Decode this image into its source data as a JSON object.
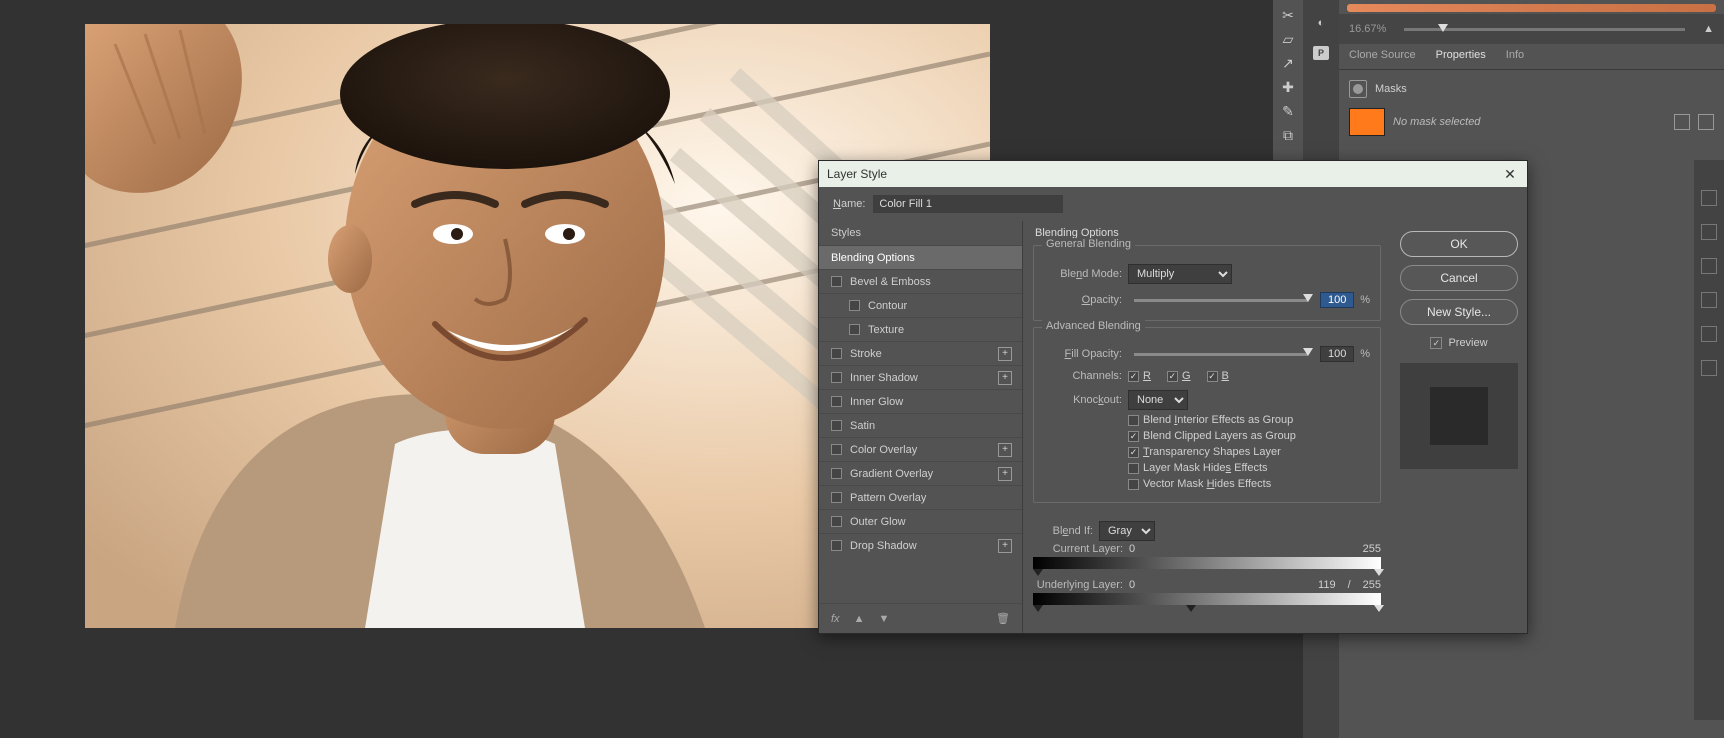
{
  "nav": {
    "zoom": "16.67%"
  },
  "tabs": {
    "clone": "Clone Source",
    "properties": "Properties",
    "info": "Info"
  },
  "properties": {
    "masks": "Masks",
    "no_mask": "No mask selected"
  },
  "dialog": {
    "title": "Layer Style",
    "name_label": "Name:",
    "name_value": "Color Fill 1",
    "styles_header": "Styles",
    "items": {
      "blending": "Blending Options",
      "bevel": "Bevel & Emboss",
      "contour": "Contour",
      "texture": "Texture",
      "stroke": "Stroke",
      "inner_shadow": "Inner Shadow",
      "inner_glow": "Inner Glow",
      "satin": "Satin",
      "color_overlay": "Color Overlay",
      "gradient_overlay": "Gradient Overlay",
      "pattern_overlay": "Pattern Overlay",
      "outer_glow": "Outer Glow",
      "drop_shadow": "Drop Shadow"
    },
    "fx_label": "fx",
    "options": {
      "title": "Blending Options",
      "general": "General Blending",
      "blend_mode": "Blend Mode:",
      "blend_mode_value": "Multiply",
      "opacity": "Opacity:",
      "opacity_value": "100",
      "pct": "%",
      "advanced": "Advanced Blending",
      "fill_opacity": "Fill Opacity:",
      "fill_value": "100",
      "channels": "Channels:",
      "ch_r": "R",
      "ch_g": "G",
      "ch_b": "B",
      "knockout": "Knockout:",
      "knockout_value": "None",
      "c1": "Blend Interior Effects as Group",
      "c2": "Blend Clipped Layers as Group",
      "c3": "Transparency Shapes Layer",
      "c4": "Layer Mask Hides Effects",
      "c5": "Vector Mask Hides Effects",
      "blendif": "Blend If:",
      "blendif_value": "Gray",
      "this_layer": "Current Layer:",
      "this_lo": "0",
      "this_hi": "255",
      "under": "Underlying Layer:",
      "under_lo": "0",
      "under_mid": "119",
      "slash": "/",
      "under_hi": "255"
    },
    "buttons": {
      "ok": "OK",
      "cancel": "Cancel",
      "new_style": "New Style...",
      "preview": "Preview"
    }
  }
}
